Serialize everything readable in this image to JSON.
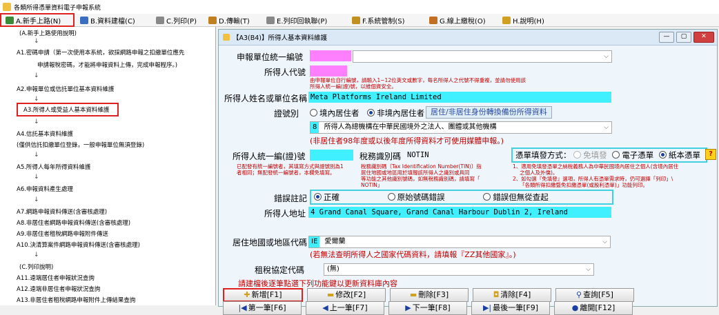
{
  "app_title": "各類所得憑單資料電子申報系統",
  "menu": [
    {
      "label": "A.新手上路(N)",
      "color": "#3a8a3a"
    },
    {
      "label": "B.資料建檔(C)",
      "color": "#3a6ec0"
    },
    {
      "label": "C.列印(P)",
      "color": "#666666"
    },
    {
      "label": "D.傳輸(T)",
      "color": "#c08020"
    },
    {
      "label": "E.列印回執聯(P)",
      "color": "#666666"
    },
    {
      "label": "F.系統管制(S)",
      "color": "#c09020"
    },
    {
      "label": "G.線上繳稅(O)",
      "color": "#c07020"
    },
    {
      "label": "H.說明(H)",
      "color": "#d0a020"
    }
  ],
  "left_nav": {
    "items": [
      {
        "label": "(A.新手上路使用說明)"
      },
      {
        "label": "↓"
      },
      {
        "label": "A1.密碼申請（第一次使用本系統，欲採網路申報之扣繳單位應先"
      },
      {
        "label": "申請報稅密碼，才能將申報資料上傳，完成申報程序。)"
      },
      {
        "label": "↓"
      },
      {
        "label": "A2.申報單位或信託單位基本資料維護"
      },
      {
        "label": "↓"
      },
      {
        "label": "A3.所得人或受益人基本資料維護"
      },
      {
        "label": "↓"
      },
      {
        "label": "A4.信託基本資料維護"
      },
      {
        "label": "(僅供信託扣繳單位登錄，一般申報單位無須登錄)"
      },
      {
        "label": "↓"
      },
      {
        "label": "A5.所得人每年所得資料維護"
      },
      {
        "label": "↓"
      },
      {
        "label": "A6.申報資料產生處理"
      },
      {
        "label": "↓"
      },
      {
        "label": "A7.網路申報資料傳送(含審核處理)"
      },
      {
        "label": "A8.非居住者網路申報資料傳送(含審核處理)"
      },
      {
        "label": "A9.非居住者租稅網路申報附件傳送"
      },
      {
        "label": "A10.決清算案件網路申報資料傳送(含審核處理)"
      },
      {
        "label": "↓"
      },
      {
        "label": "(C.列印說明)"
      },
      {
        "label": "A11.遠端居住者申報狀況查詢"
      },
      {
        "label": "A12.遠端非居住者申報狀況查詢"
      },
      {
        "label": "A13.非居住者租稅網路申報附件上傳結果查詢"
      }
    ]
  },
  "window": {
    "title": "【A3(B4)】所得人基本資料維護",
    "btn_min": "—",
    "btn_max": "▢",
    "btn_close": "✕"
  },
  "form": {
    "unit_id_label": "申報單位統一編號",
    "person_code_label": "所得人代號",
    "person_code_hint1": "由申報單位自行編號，請輸入1~12位英文或數字，每名所得人之代號不得重複，並請勿使用該",
    "person_code_hint2": "所得人統一編(證)號，以維個資安全。",
    "name_label": "所得人姓名或單位名稱",
    "name_value": "Meta Platforms Ireland Limited",
    "id_type_label": "證號別",
    "id_type_opt1": "境內居住者",
    "id_type_opt2": "非境內居住者",
    "id_type_link": "居住/非居住身份轉換備份所得資料",
    "category_code": "8",
    "category_text": "所得人為總機構在中華民國境外之法人、團體或其他機構",
    "category_note": "(非居住者98年度或以後年度所得資料才可使用媒體申報。)",
    "uid_label": "所得人統一編(證)號",
    "tin_label": "稅務識別碼",
    "tin_value": "NOTIN",
    "uid_hint1": "已配發有統一編號者，其填寫方式與證號別為1",
    "uid_hint2": "者相同；無配發統一編號者，本欄免填寫。",
    "tin_hint1": "稅務識別碼〔Tax Identification Number(TIN)〕指",
    "tin_hint2": "居住地國或地區用於填報該所得人之識別或具同",
    "tin_hint3": "等功能之其他識別號碼，如無稅務識別碼，請填寫「",
    "tin_hint4": "NOTIN」",
    "voucher_label": "憑單填發方式：",
    "voucher_opt1": "免填發",
    "voucher_opt2": "電子憑單",
    "voucher_opt3": "紙本憑單",
    "voucher_hint1": "1、適用免填發憑單之納稅義務人為中華民國境內居住之個人(含境內居住",
    "voucher_hint2": "之個人及外僑)。",
    "voucher_hint3": "2、如勾選『免填發』選項，所得人有憑單需求時，仍可選擇「列印」\\",
    "voucher_hint4": "「各類所得扣繳暨免扣繳憑單(或股利憑單)」功能列印。",
    "help_q": "?",
    "error_label": "錯誤註記",
    "err_opt1": "正確",
    "err_opt2": "原始號碼錯誤",
    "err_opt3": "錯誤但無從查起",
    "address_label": "所得人地址",
    "address_value": "4 Grand Canal Square, Grand Canal Harbour Dublin 2, Ireland",
    "country_label": "居住地國或地區代碼",
    "country_code": "IE",
    "country_name": "愛爾蘭",
    "country_note": "(若無法查明所得人之國家代碼資料，請填報『ZZ其他國家』。)",
    "treaty_label": "租稅協定代碼",
    "treaty_value": "(無)",
    "update_note": "請建檔後逐筆點選下列功能鍵以更新資料庫內容"
  },
  "buttons_row1": [
    "新增[F1]",
    "修改[F2]",
    "刪除[F3]",
    "清除[F4]",
    "查詢[F5]"
  ],
  "buttons_row2": [
    "第一筆[F6]",
    "上一筆[F7]",
    "下一筆[F8]",
    "最後一筆[F9]",
    "離開[F12]"
  ],
  "buttons_row1_icons": [
    "✚",
    "▬",
    "▬",
    "◘",
    "⚲"
  ],
  "buttons_row2_icons": [
    "|◀",
    "◀",
    "▶",
    "▶|",
    "●"
  ]
}
